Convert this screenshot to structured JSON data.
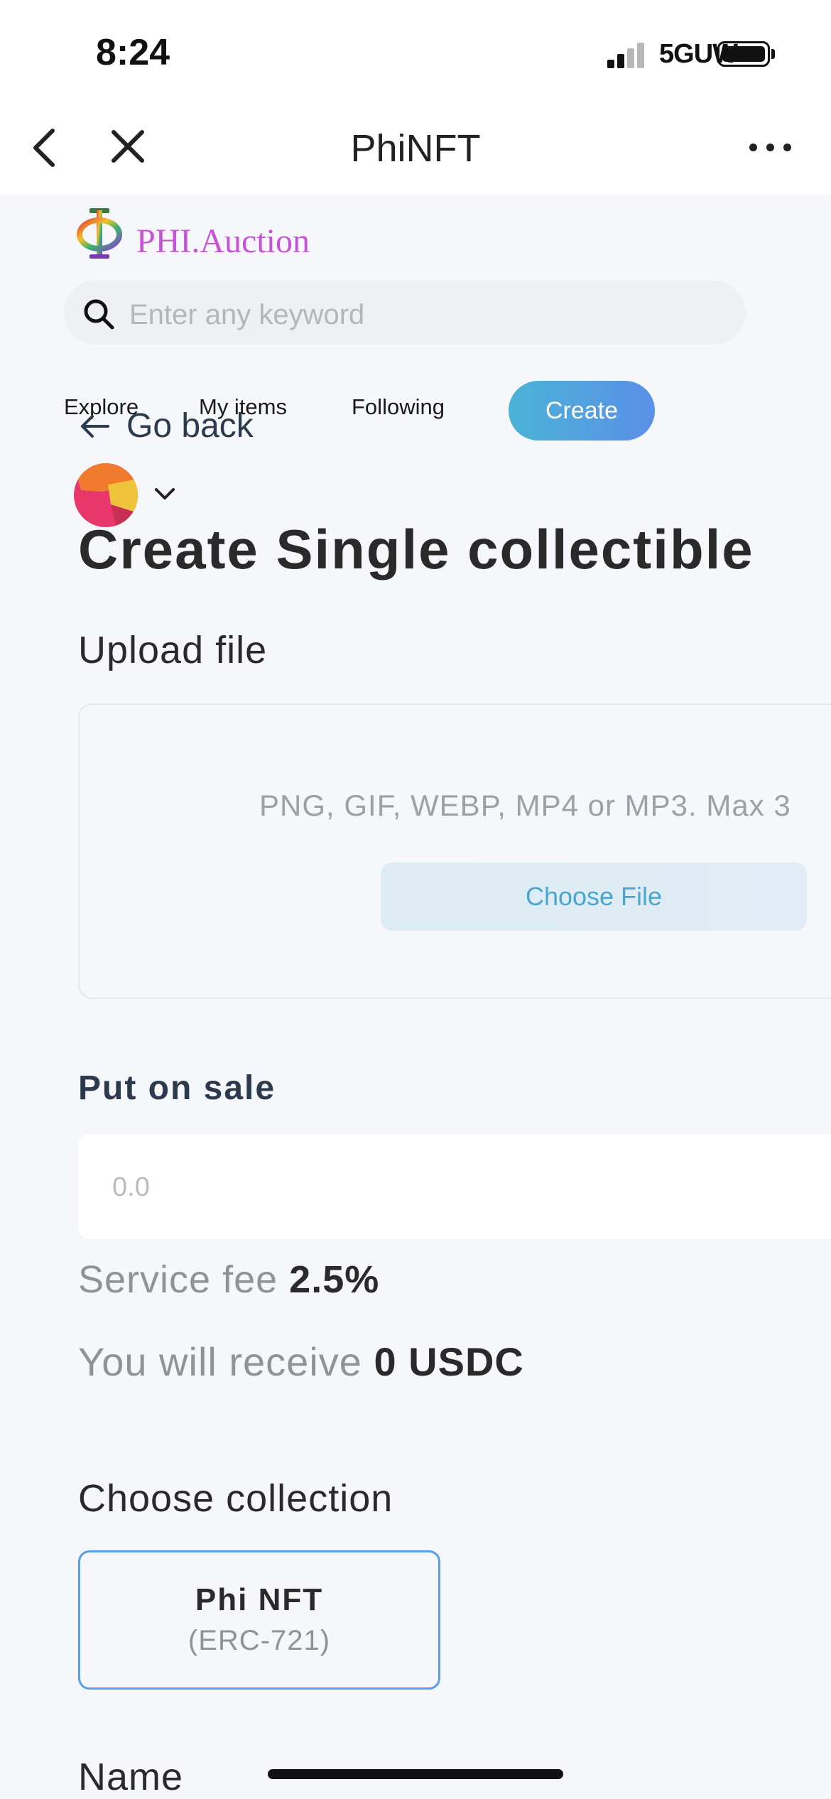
{
  "status_bar": {
    "time": "8:24",
    "network": "5GUW"
  },
  "header": {
    "title": "PhiNFT"
  },
  "brand": {
    "name": "PHI.Auction",
    "color": "#c653d6"
  },
  "search": {
    "placeholder": "Enter any keyword"
  },
  "nav": {
    "items": [
      {
        "label": "Explore"
      },
      {
        "label": "My items"
      },
      {
        "label": "Following"
      }
    ],
    "create_label": "Create"
  },
  "go_back": {
    "label": "Go back"
  },
  "page": {
    "title": "Create Single collectible"
  },
  "upload": {
    "heading": "Upload file",
    "hint": "PNG, GIF, WEBP, MP4 or MP3. Max 3",
    "button_label": "Choose File"
  },
  "sale": {
    "heading": "Put on sale",
    "price_placeholder": "0.0",
    "service_fee_label": "Service fee",
    "service_fee_value": "2.5%",
    "receive_label": "You will receive",
    "receive_value": "0 USDC"
  },
  "collection": {
    "heading": "Choose collection",
    "selected": {
      "name": "Phi NFT",
      "standard": "(ERC-721)"
    }
  },
  "name_field": {
    "heading": "Name"
  },
  "colors": {
    "accent_blue": "#5a9ee8",
    "create_gradient_start": "#4ab4d6",
    "create_gradient_end": "#5b8fe8",
    "background": "#f5f7fa"
  }
}
